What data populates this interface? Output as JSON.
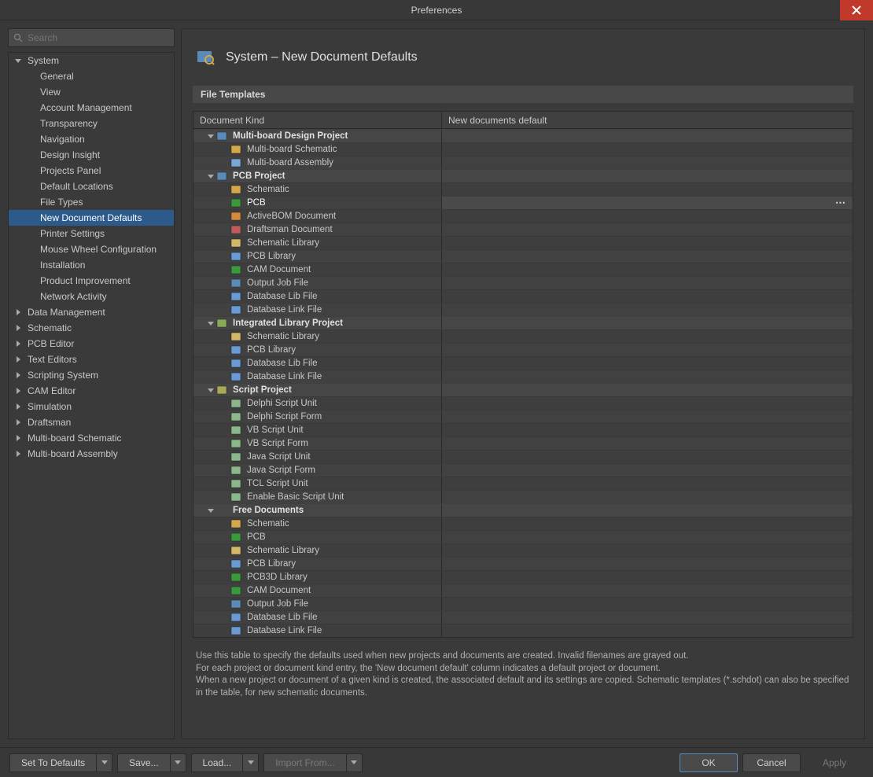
{
  "window": {
    "title": "Preferences"
  },
  "search": {
    "placeholder": "Search"
  },
  "nav": [
    {
      "label": "System",
      "level": 0,
      "expanded": true
    },
    {
      "label": "General",
      "level": 1
    },
    {
      "label": "View",
      "level": 1
    },
    {
      "label": "Account Management",
      "level": 1
    },
    {
      "label": "Transparency",
      "level": 1
    },
    {
      "label": "Navigation",
      "level": 1
    },
    {
      "label": "Design Insight",
      "level": 1
    },
    {
      "label": "Projects Panel",
      "level": 1
    },
    {
      "label": "Default Locations",
      "level": 1
    },
    {
      "label": "File Types",
      "level": 1
    },
    {
      "label": "New Document Defaults",
      "level": 1,
      "selected": true
    },
    {
      "label": "Printer Settings",
      "level": 1
    },
    {
      "label": "Mouse Wheel Configuration",
      "level": 1
    },
    {
      "label": "Installation",
      "level": 1
    },
    {
      "label": "Product Improvement",
      "level": 1
    },
    {
      "label": "Network Activity",
      "level": 1
    },
    {
      "label": "Data Management",
      "level": 0,
      "expanded": false
    },
    {
      "label": "Schematic",
      "level": 0,
      "expanded": false
    },
    {
      "label": "PCB Editor",
      "level": 0,
      "expanded": false
    },
    {
      "label": "Text Editors",
      "level": 0,
      "expanded": false
    },
    {
      "label": "Scripting System",
      "level": 0,
      "expanded": false
    },
    {
      "label": "CAM Editor",
      "level": 0,
      "expanded": false
    },
    {
      "label": "Simulation",
      "level": 0,
      "expanded": false
    },
    {
      "label": "Draftsman",
      "level": 0,
      "expanded": false
    },
    {
      "label": "Multi-board Schematic",
      "level": 0,
      "expanded": false
    },
    {
      "label": "Multi-board Assembly",
      "level": 0,
      "expanded": false
    }
  ],
  "content": {
    "title": "System – New Document Defaults",
    "section_title": "File Templates",
    "columns": {
      "c1": "Document Kind",
      "c2": "New documents default"
    },
    "rows": [
      {
        "type": "group",
        "label": "Multi-board Design Project",
        "icon": "project"
      },
      {
        "type": "child",
        "label": "Multi-board Schematic",
        "icon": "schematic"
      },
      {
        "type": "child",
        "label": "Multi-board Assembly",
        "icon": "assembly"
      },
      {
        "type": "group",
        "label": "PCB Project",
        "icon": "project"
      },
      {
        "type": "child",
        "label": "Schematic",
        "icon": "schematic"
      },
      {
        "type": "child",
        "label": "PCB",
        "icon": "pcb",
        "selected": true
      },
      {
        "type": "child",
        "label": "ActiveBOM Document",
        "icon": "bom"
      },
      {
        "type": "child",
        "label": "Draftsman Document",
        "icon": "draftsman"
      },
      {
        "type": "child",
        "label": "Schematic Library",
        "icon": "schlib"
      },
      {
        "type": "child",
        "label": "PCB Library",
        "icon": "pcblib"
      },
      {
        "type": "child",
        "label": "CAM Document",
        "icon": "cam"
      },
      {
        "type": "child",
        "label": "Output Job File",
        "icon": "outjob"
      },
      {
        "type": "child",
        "label": "Database Lib File",
        "icon": "dblib"
      },
      {
        "type": "child",
        "label": "Database Link File",
        "icon": "dblink"
      },
      {
        "type": "group",
        "label": "Integrated Library Project",
        "icon": "intlib"
      },
      {
        "type": "child",
        "label": "Schematic Library",
        "icon": "schlib"
      },
      {
        "type": "child",
        "label": "PCB Library",
        "icon": "pcblib"
      },
      {
        "type": "child",
        "label": "Database Lib File",
        "icon": "dblib"
      },
      {
        "type": "child",
        "label": "Database Link File",
        "icon": "dblink"
      },
      {
        "type": "group",
        "label": "Script Project",
        "icon": "script"
      },
      {
        "type": "child",
        "label": "Delphi Script Unit",
        "icon": "scriptunit"
      },
      {
        "type": "child",
        "label": "Delphi Script Form",
        "icon": "scriptform"
      },
      {
        "type": "child",
        "label": "VB Script Unit",
        "icon": "scriptunit"
      },
      {
        "type": "child",
        "label": "VB Script Form",
        "icon": "scriptform"
      },
      {
        "type": "child",
        "label": "Java Script Unit",
        "icon": "scriptunit"
      },
      {
        "type": "child",
        "label": "Java Script Form",
        "icon": "scriptform"
      },
      {
        "type": "child",
        "label": "TCL Script Unit",
        "icon": "scriptunit"
      },
      {
        "type": "child",
        "label": "Enable Basic Script Unit",
        "icon": "scriptunit"
      },
      {
        "type": "group",
        "label": "Free Documents",
        "icon": "",
        "noicon": true
      },
      {
        "type": "child",
        "label": "Schematic",
        "icon": "schematic"
      },
      {
        "type": "child",
        "label": "PCB",
        "icon": "pcb"
      },
      {
        "type": "child",
        "label": "Schematic Library",
        "icon": "schlib"
      },
      {
        "type": "child",
        "label": "PCB Library",
        "icon": "pcblib"
      },
      {
        "type": "child",
        "label": "PCB3D Library",
        "icon": "pcb3d"
      },
      {
        "type": "child",
        "label": "CAM Document",
        "icon": "cam"
      },
      {
        "type": "child",
        "label": "Output Job File",
        "icon": "outjob"
      },
      {
        "type": "child",
        "label": "Database Lib File",
        "icon": "dblib"
      },
      {
        "type": "child",
        "label": "Database Link File",
        "icon": "dblink"
      }
    ],
    "help1": "Use this table to specify the defaults used when new projects and documents are created. Invalid filenames are grayed out.",
    "help2": "For each project or document kind entry, the 'New document default' column indicates a default project or document.",
    "help3": "When a new project or document of a given kind is created, the associated default and its settings are copied. Schematic templates (*.schdot) can also be specified in the table, for new schematic documents."
  },
  "footer": {
    "set_defaults": "Set To Defaults",
    "save": "Save...",
    "load": "Load...",
    "import": "Import From...",
    "ok": "OK",
    "cancel": "Cancel",
    "apply": "Apply"
  },
  "icon_colors": {
    "project": "#5a8ab8",
    "schematic": "#d4a84a",
    "assembly": "#7aa8d4",
    "pcb": "#3a9a3a",
    "bom": "#d48a3a",
    "draftsman": "#c05a5a",
    "schlib": "#d4b86a",
    "pcblib": "#6a9ad4",
    "cam": "#3a9a3a",
    "outjob": "#5a8ab8",
    "dblib": "#6a9ad4",
    "dblink": "#6a9ad4",
    "intlib": "#8aa85a",
    "script": "#a8a85a",
    "scriptunit": "#8ab88a",
    "scriptform": "#8ab88a",
    "pcb3d": "#3a9a3a"
  }
}
